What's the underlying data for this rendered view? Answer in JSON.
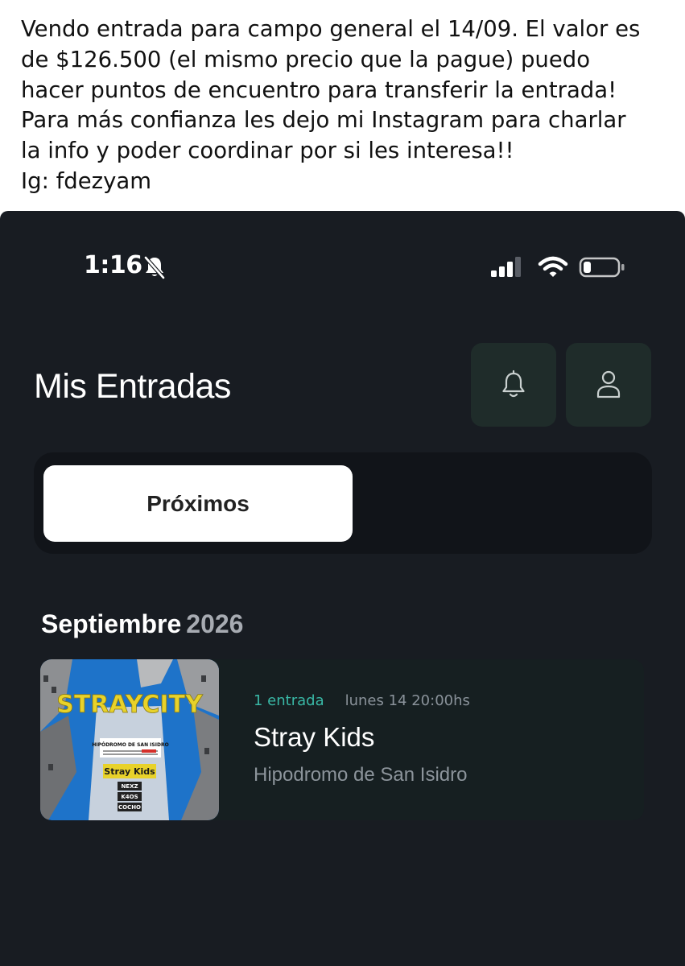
{
  "post": {
    "lines": [
      "Vendo entrada para campo general el 14/09. El valor es",
      "de $126.500 (el mismo precio que la pague) puedo",
      "hacer puntos de encuentro para transferir la entrada!",
      "Para más confianza les dejo mi Instagram para charlar",
      "la info y poder coordinar por si les interesa!!",
      "Ig: fdezyam"
    ]
  },
  "status_bar": {
    "time": "1:16",
    "icons": [
      "bell-slash-icon",
      "cellular-signal-icon",
      "wifi-icon",
      "battery-icon"
    ]
  },
  "header": {
    "title": "Mis Entradas",
    "buttons": [
      "notifications-bell-icon",
      "profile-user-icon"
    ]
  },
  "tabs": {
    "active_label": "Próximos"
  },
  "section": {
    "month": "Septiembre",
    "year": "2026"
  },
  "event": {
    "ticket_count": "1 entrada",
    "datetime": "lunes 14 20:00hs",
    "name": "Stray Kids",
    "venue": "Hipodromo de San Isidro",
    "poster": {
      "title": "STRAYCITY",
      "venue": "HIPÓDROMO DE SAN ISIDRO",
      "headliner": "Stray Kids",
      "acts": [
        "NEXZ",
        "K4OS",
        "COCHO"
      ]
    }
  },
  "colors": {
    "app_background": "#181c22",
    "accent": "#39b8a6",
    "icon_button_bg": "#1f2c2a",
    "card_bg": "#161f21",
    "poster_blue": "#1e73c9",
    "poster_yellow": "#e8d22a"
  }
}
